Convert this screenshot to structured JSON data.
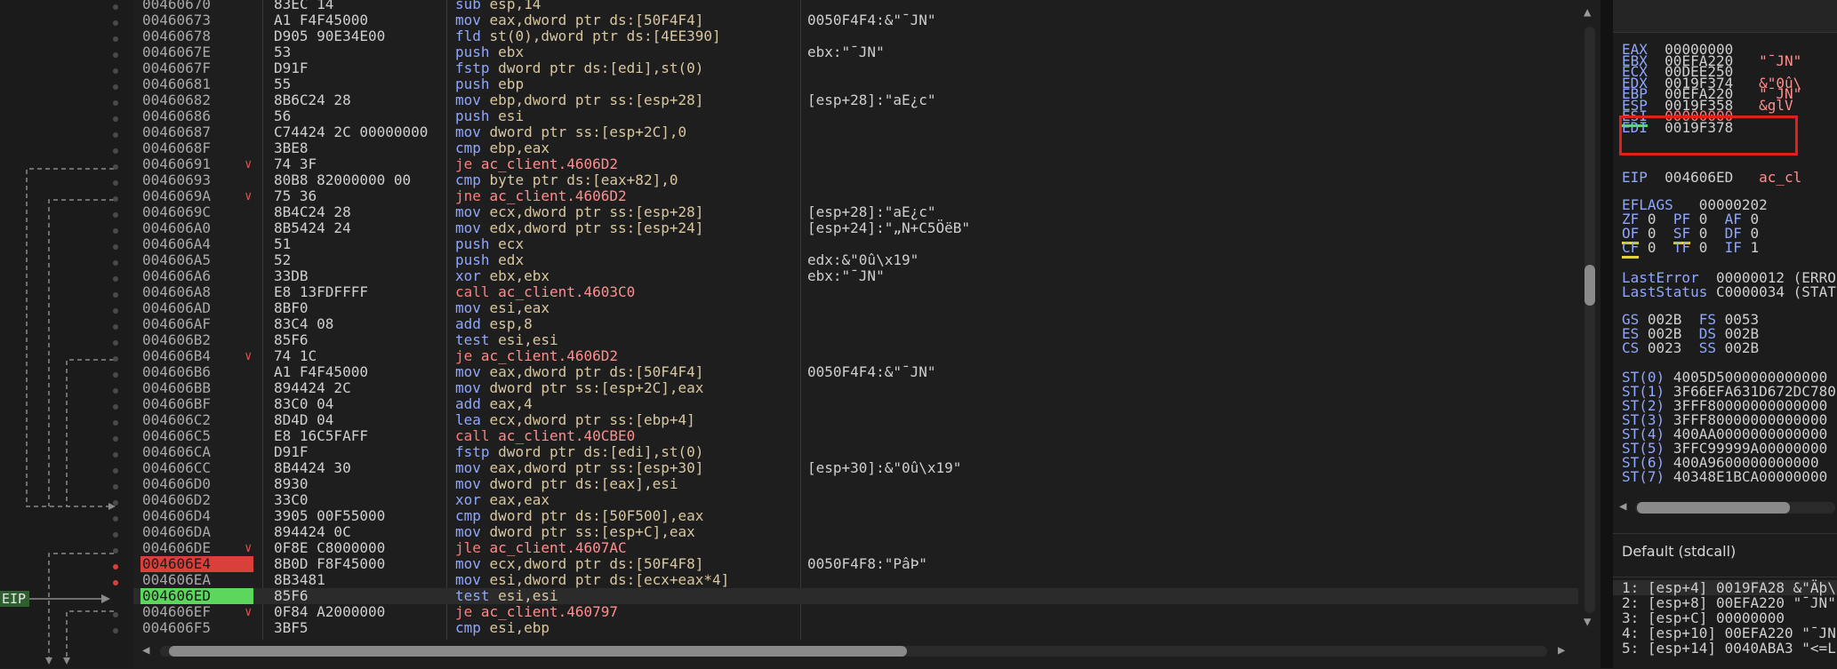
{
  "colors": {
    "breakpoint": "#d9403a",
    "eip_highlight": "#5cd65c",
    "highlight_box": "#e0201a",
    "mnemonic": "#8fa7ff",
    "jump_call": "#ff7b7b"
  },
  "eip_label": "EIP",
  "disasm": [
    {
      "addr": "00460670",
      "bytes": "83EC 14",
      "mn": "sub",
      "op": "esp,14",
      "cmt": "",
      "type": "normal"
    },
    {
      "addr": "00460673",
      "bytes": "A1 F4F45000",
      "mn": "mov",
      "op": "eax,dword ptr ds:[50F4F4]",
      "cmt": "0050F4F4:&\"¯JN\"",
      "type": "normal"
    },
    {
      "addr": "00460678",
      "bytes": "D905 90E34E00",
      "mn": "fld",
      "op": "st(0),dword ptr ds:[4EE390]",
      "cmt": "",
      "type": "normal"
    },
    {
      "addr": "0046067E",
      "bytes": "53",
      "mn": "push",
      "op": "ebx",
      "cmt": "ebx:\"¯JN\"",
      "type": "normal"
    },
    {
      "addr": "0046067F",
      "bytes": "D91F",
      "mn": "fstp",
      "op": "dword ptr ds:[edi],st(0)",
      "cmt": "",
      "type": "normal"
    },
    {
      "addr": "00460681",
      "bytes": "55",
      "mn": "push",
      "op": "ebp",
      "cmt": "",
      "type": "normal"
    },
    {
      "addr": "00460682",
      "bytes": "8B6C24 28",
      "mn": "mov",
      "op": "ebp,dword ptr ss:[esp+28]",
      "cmt": "[esp+28]:\"aE¿c\"",
      "type": "normal"
    },
    {
      "addr": "00460686",
      "bytes": "56",
      "mn": "push",
      "op": "esi",
      "cmt": "",
      "type": "normal"
    },
    {
      "addr": "00460687",
      "bytes": "C74424 2C 00000000",
      "mn": "mov",
      "op": "dword ptr ss:[esp+2C],0",
      "cmt": "",
      "type": "normal"
    },
    {
      "addr": "0046068F",
      "bytes": "3BE8",
      "mn": "cmp",
      "op": "ebp,eax",
      "cmt": "",
      "type": "normal"
    },
    {
      "addr": "00460691",
      "bytes": "74 3F",
      "mn": "je",
      "op": "ac_client.4606D2",
      "cmt": "",
      "type": "jmp",
      "mark": "v"
    },
    {
      "addr": "00460693",
      "bytes": "80B8 82000000 00",
      "mn": "cmp",
      "op": "byte ptr ds:[eax+82],0",
      "cmt": "",
      "type": "normal"
    },
    {
      "addr": "0046069A",
      "bytes": "75 36",
      "mn": "jne",
      "op": "ac_client.4606D2",
      "cmt": "",
      "type": "jmp",
      "mark": "v"
    },
    {
      "addr": "0046069C",
      "bytes": "8B4C24 28",
      "mn": "mov",
      "op": "ecx,dword ptr ss:[esp+28]",
      "cmt": "[esp+28]:\"aE¿c\"",
      "type": "normal"
    },
    {
      "addr": "004606A0",
      "bytes": "8B5424 24",
      "mn": "mov",
      "op": "edx,dword ptr ss:[esp+24]",
      "cmt": "[esp+24]:\"„N+C5ÖëB\"",
      "type": "normal"
    },
    {
      "addr": "004606A4",
      "bytes": "51",
      "mn": "push",
      "op": "ecx",
      "cmt": "",
      "type": "normal"
    },
    {
      "addr": "004606A5",
      "bytes": "52",
      "mn": "push",
      "op": "edx",
      "cmt": "edx:&\"0û\\x19\"",
      "type": "normal"
    },
    {
      "addr": "004606A6",
      "bytes": "33DB",
      "mn": "xor",
      "op": "ebx,ebx",
      "cmt": "ebx:\"¯JN\"",
      "type": "normal"
    },
    {
      "addr": "004606A8",
      "bytes": "E8 13FDFFFF",
      "mn": "call",
      "op": "ac_client.4603C0",
      "cmt": "",
      "type": "call"
    },
    {
      "addr": "004606AD",
      "bytes": "8BF0",
      "mn": "mov",
      "op": "esi,eax",
      "cmt": "",
      "type": "normal"
    },
    {
      "addr": "004606AF",
      "bytes": "83C4 08",
      "mn": "add",
      "op": "esp,8",
      "cmt": "",
      "type": "normal"
    },
    {
      "addr": "004606B2",
      "bytes": "85F6",
      "mn": "test",
      "op": "esi,esi",
      "cmt": "",
      "type": "normal"
    },
    {
      "addr": "004606B4",
      "bytes": "74 1C",
      "mn": "je",
      "op": "ac_client.4606D2",
      "cmt": "",
      "type": "jmp",
      "mark": "v"
    },
    {
      "addr": "004606B6",
      "bytes": "A1 F4F45000",
      "mn": "mov",
      "op": "eax,dword ptr ds:[50F4F4]",
      "cmt": "0050F4F4:&\"¯JN\"",
      "type": "normal"
    },
    {
      "addr": "004606BB",
      "bytes": "894424 2C",
      "mn": "mov",
      "op": "dword ptr ss:[esp+2C],eax",
      "cmt": "",
      "type": "normal"
    },
    {
      "addr": "004606BF",
      "bytes": "83C0 04",
      "mn": "add",
      "op": "eax,4",
      "cmt": "",
      "type": "normal"
    },
    {
      "addr": "004606C2",
      "bytes": "8D4D 04",
      "mn": "lea",
      "op": "ecx,dword ptr ss:[ebp+4]",
      "cmt": "",
      "type": "normal"
    },
    {
      "addr": "004606C5",
      "bytes": "E8 16C5FAFF",
      "mn": "call",
      "op": "ac_client.40CBE0",
      "cmt": "",
      "type": "call"
    },
    {
      "addr": "004606CA",
      "bytes": "D91F",
      "mn": "fstp",
      "op": "dword ptr ds:[edi],st(0)",
      "cmt": "",
      "type": "normal"
    },
    {
      "addr": "004606CC",
      "bytes": "8B4424 30",
      "mn": "mov",
      "op": "eax,dword ptr ss:[esp+30]",
      "cmt": "[esp+30]:&\"0û\\x19\"",
      "type": "normal"
    },
    {
      "addr": "004606D0",
      "bytes": "8930",
      "mn": "mov",
      "op": "dword ptr ds:[eax],esi",
      "cmt": "",
      "type": "normal"
    },
    {
      "addr": "004606D2",
      "bytes": "33C0",
      "mn": "xor",
      "op": "eax,eax",
      "cmt": "",
      "type": "normal"
    },
    {
      "addr": "004606D4",
      "bytes": "3905 00F55000",
      "mn": "cmp",
      "op": "dword ptr ds:[50F500],eax",
      "cmt": "",
      "type": "normal"
    },
    {
      "addr": "004606DA",
      "bytes": "894424 0C",
      "mn": "mov",
      "op": "dword ptr ss:[esp+C],eax",
      "cmt": "",
      "type": "normal"
    },
    {
      "addr": "004606DE",
      "bytes": "0F8E C8000000",
      "mn": "jle",
      "op": "ac_client.4607AC",
      "cmt": "",
      "type": "jmp",
      "mark": "v"
    },
    {
      "addr": "004606E4",
      "bytes": "8B0D F8F45000",
      "mn": "mov",
      "op": "ecx,dword ptr ds:[50F4F8]",
      "cmt": "0050F4F8:\"PâÞ\"",
      "type": "normal",
      "addr_style": "bp"
    },
    {
      "addr": "004606EA",
      "bytes": "8B3481",
      "mn": "mov",
      "op": "esi,dword ptr ds:[ecx+eax*4]",
      "cmt": "",
      "type": "normal"
    },
    {
      "addr": "004606ED",
      "bytes": "85F6",
      "mn": "test",
      "op": "esi,esi",
      "cmt": "",
      "type": "normal",
      "addr_style": "eip",
      "current": true
    },
    {
      "addr": "004606EF",
      "bytes": "0F84 A2000000",
      "mn": "je",
      "op": "ac_client.460797",
      "cmt": "",
      "type": "jmp",
      "mark": "v"
    },
    {
      "addr": "004606F5",
      "bytes": "3BF5",
      "mn": "cmp",
      "op": "esi,ebp",
      "cmt": "",
      "type": "normal"
    }
  ],
  "registers": {
    "gp": [
      {
        "name": "EAX",
        "value": "00000000",
        "comment": ""
      },
      {
        "name": "EBX",
        "value": "00EFA220",
        "comment": "\"¯JN\""
      },
      {
        "name": "ECX",
        "value": "00DEE250",
        "comment": ""
      },
      {
        "name": "EDX",
        "value": "0019F374",
        "comment": "&\"0û\\"
      },
      {
        "name": "EBP",
        "value": "00EFA220",
        "comment": "\"¯JN\""
      },
      {
        "name": "ESP",
        "value": "0019F358",
        "comment": "&glV"
      },
      {
        "name": "ESI",
        "value": "00000000",
        "comment": ""
      },
      {
        "name": "EDI",
        "value": "0019F378",
        "comment": ""
      }
    ],
    "eip": {
      "name": "EIP",
      "value": "004606ED",
      "comment": "ac_cl"
    },
    "eflags": {
      "name": "EFLAGS",
      "value": "00000202"
    },
    "flags": [
      [
        {
          "n": "ZF",
          "v": "0"
        },
        {
          "n": "PF",
          "v": "0"
        },
        {
          "n": "AF",
          "v": "0"
        }
      ],
      [
        {
          "n": "OF",
          "v": "0"
        },
        {
          "n": "SF",
          "v": "0"
        },
        {
          "n": "DF",
          "v": "0"
        }
      ],
      [
        {
          "n": "CF",
          "v": "0"
        },
        {
          "n": "TF",
          "v": "0"
        },
        {
          "n": "IF",
          "v": "1"
        }
      ]
    ],
    "last_error": {
      "name": "LastError",
      "value": "00000012 (ERRO"
    },
    "last_status": {
      "name": "LastStatus",
      "value": "C0000034 (STAT"
    },
    "segments": [
      [
        {
          "n": "GS",
          "v": "002B"
        },
        {
          "n": "FS",
          "v": "0053"
        }
      ],
      [
        {
          "n": "ES",
          "v": "002B"
        },
        {
          "n": "DS",
          "v": "002B"
        }
      ],
      [
        {
          "n": "CS",
          "v": "0023"
        },
        {
          "n": "SS",
          "v": "002B"
        }
      ]
    ],
    "fpu": [
      {
        "n": "ST(0)",
        "v": "4005D5000000000000"
      },
      {
        "n": "ST(1)",
        "v": "3F66EFA631D672DC780"
      },
      {
        "n": "ST(2)",
        "v": "3FFF80000000000000"
      },
      {
        "n": "ST(3)",
        "v": "3FFF80000000000000"
      },
      {
        "n": "ST(4)",
        "v": "400AA0000000000000"
      },
      {
        "n": "ST(5)",
        "v": "3FFC99999A00000000"
      },
      {
        "n": "ST(6)",
        "v": "400A9600000000000"
      },
      {
        "n": "ST(7)",
        "v": "40348E1BCA00000000"
      }
    ]
  },
  "callstack": {
    "header": "Default (stdcall)",
    "rows": [
      "1: [esp+4] 0019FA28 &\"Äþ\\",
      "2: [esp+8] 00EFA220 \"¯JN\"",
      "3: [esp+C] 00000000",
      "4: [esp+10] 00EFA220 \"¯JN",
      "5: [esp+14] 0040ABA3 \"<=L"
    ]
  }
}
